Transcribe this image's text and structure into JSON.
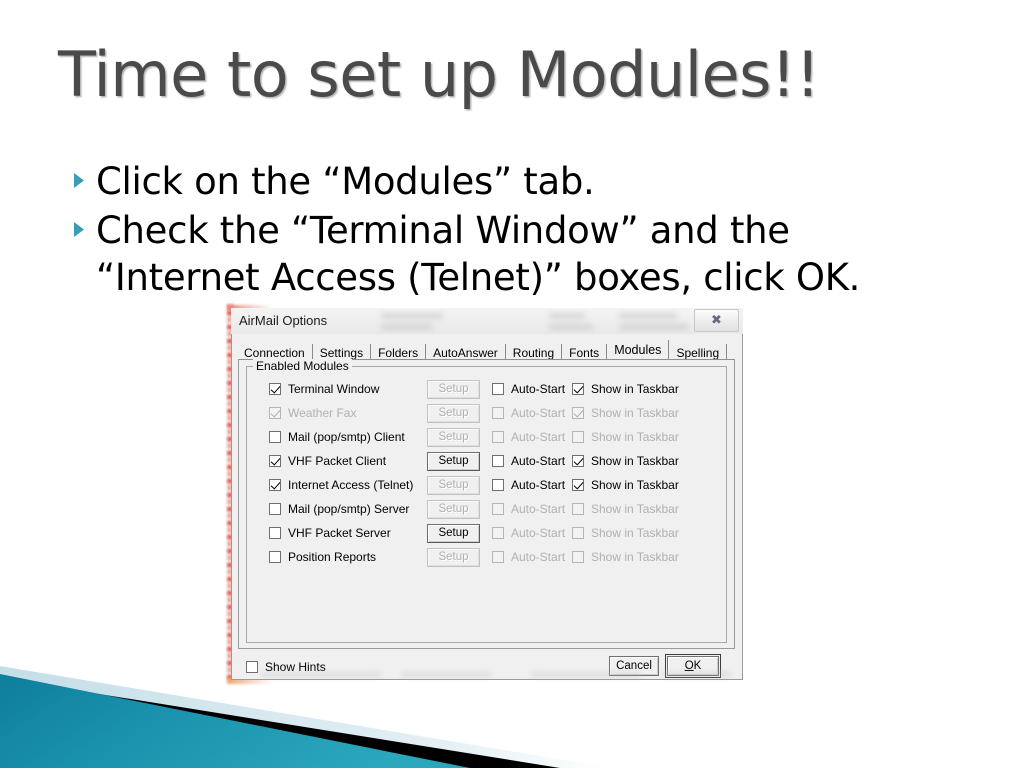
{
  "slide": {
    "title": "Time to set up Modules!!",
    "bullets": [
      {
        "lines": [
          "Click on the “Modules” tab."
        ]
      },
      {
        "lines": [
          "Check the “Terminal Window” and the",
          "“Internet Access (Telnet)” boxes, click OK."
        ]
      }
    ],
    "bullet_color": "#3c9cb8",
    "title_color": "#4a4a4a",
    "accent_teal": "#1a8fab",
    "accent_lightblue": "#d7e8ef",
    "accent_black": "#000000"
  },
  "dialog": {
    "title": "AirMail Options",
    "close_icon": "✖",
    "tabs": [
      {
        "label": "Connection",
        "active": false
      },
      {
        "label": "Settings",
        "active": false
      },
      {
        "label": "Folders",
        "active": false
      },
      {
        "label": "AutoAnswer",
        "active": false
      },
      {
        "label": "Routing",
        "active": false
      },
      {
        "label": "Fonts",
        "active": false
      },
      {
        "label": "Modules",
        "active": true
      },
      {
        "label": "Spelling",
        "active": false
      }
    ],
    "group_label": "Enabled Modules",
    "column_labels": {
      "setup": "Setup",
      "auto_start": "Auto-Start",
      "show_in_taskbar": "Show in Taskbar"
    },
    "modules": [
      {
        "name": "Terminal Window",
        "enabled_checked": true,
        "enabled_dim": false,
        "setup_enabled": false,
        "auto_start_checked": false,
        "auto_start_dim": false,
        "taskbar_checked": true,
        "taskbar_dim": false
      },
      {
        "name": "Weather Fax",
        "enabled_checked": true,
        "enabled_dim": true,
        "setup_enabled": false,
        "auto_start_checked": false,
        "auto_start_dim": true,
        "taskbar_checked": true,
        "taskbar_dim": true
      },
      {
        "name": "Mail (pop/smtp) Client",
        "enabled_checked": false,
        "enabled_dim": false,
        "setup_enabled": false,
        "auto_start_checked": false,
        "auto_start_dim": true,
        "taskbar_checked": false,
        "taskbar_dim": true
      },
      {
        "name": "VHF Packet Client",
        "enabled_checked": true,
        "enabled_dim": false,
        "setup_enabled": true,
        "auto_start_checked": false,
        "auto_start_dim": false,
        "taskbar_checked": true,
        "taskbar_dim": false
      },
      {
        "name": "Internet Access (Telnet)",
        "enabled_checked": true,
        "enabled_dim": false,
        "setup_enabled": false,
        "auto_start_checked": false,
        "auto_start_dim": false,
        "taskbar_checked": true,
        "taskbar_dim": false
      },
      {
        "name": "Mail (pop/smtp) Server",
        "enabled_checked": false,
        "enabled_dim": false,
        "setup_enabled": false,
        "auto_start_checked": false,
        "auto_start_dim": true,
        "taskbar_checked": false,
        "taskbar_dim": true
      },
      {
        "name": "VHF Packet Server",
        "enabled_checked": false,
        "enabled_dim": false,
        "setup_enabled": true,
        "auto_start_checked": false,
        "auto_start_dim": true,
        "taskbar_checked": false,
        "taskbar_dim": true
      },
      {
        "name": "Position Reports",
        "enabled_checked": false,
        "enabled_dim": false,
        "setup_enabled": false,
        "auto_start_checked": false,
        "auto_start_dim": true,
        "taskbar_checked": false,
        "taskbar_dim": true
      }
    ],
    "show_hints": {
      "label": "Show Hints",
      "checked": false
    },
    "cancel_label": "Cancel",
    "ok_label_prefix": "O",
    "ok_label_suffix": "K"
  }
}
